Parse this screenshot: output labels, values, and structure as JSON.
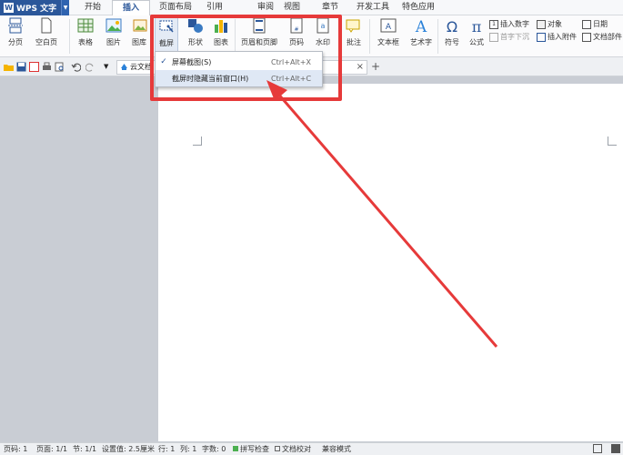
{
  "app": {
    "name": "WPS 文字",
    "logo_letter": "W"
  },
  "menu_tabs": [
    "开始",
    "插入",
    "页面布局",
    "引用",
    "审阅",
    "视图",
    "章节",
    "开发工具",
    "特色应用"
  ],
  "active_tab": "插入",
  "ribbon": {
    "page_break": "分页",
    "blank_page": "空白页",
    "table": "表格",
    "picture": "图片",
    "gallery": "图库",
    "screenshot": "截屏",
    "shapes": "形状",
    "chart": "图表",
    "header_footer": "页眉和页脚",
    "page_number": "页码",
    "watermark": "水印",
    "comment": "批注",
    "textbox": "文本框",
    "wordart": "艺术字",
    "symbol": "符号",
    "formula": "公式",
    "insert_number": "插入数字",
    "object": "对象",
    "date": "日期",
    "dropcap": "首字下沉",
    "attachment": "插入附件",
    "doc_parts": "文档部件"
  },
  "quickbar": {
    "cloud_doc_label": "云文档",
    "new_tab_symbol": "+",
    "close_symbol": "×"
  },
  "dropdown": {
    "items": [
      {
        "label": "屏幕截图(S)",
        "shortcut": "Ctrl+Alt+X",
        "checked": true
      },
      {
        "label": "截屏时隐藏当前窗口(H)",
        "shortcut": "Ctrl+Alt+C",
        "checked": false
      }
    ],
    "check_symbol": "✓"
  },
  "status": {
    "page_num": "页码: 1",
    "pages": "页面: 1/1",
    "section": "节: 1/1",
    "setting": "设置值: 2.5厘米",
    "row": "行: 1",
    "col": "列: 1",
    "words": "字数: 0",
    "spellcheck": "拼写检查",
    "doc_proof": "文档校对",
    "compat": "兼容模式"
  },
  "colors": {
    "accent": "#2b579a",
    "highlight": "#e63a3a",
    "hover": "#dfe8f5"
  }
}
